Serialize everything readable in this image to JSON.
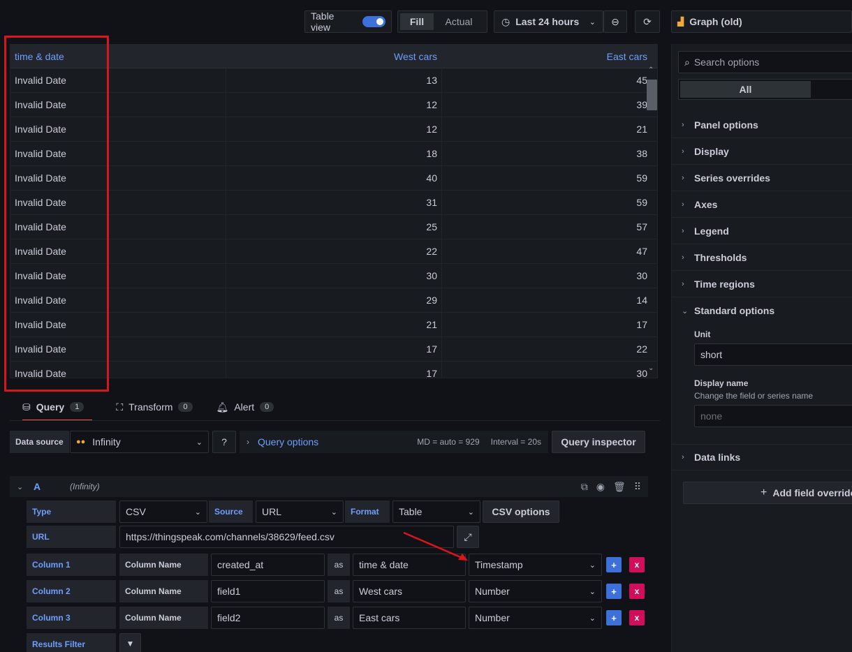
{
  "toolbar": {
    "table_view_label": "Table view",
    "fill_label": "Fill",
    "actual_label": "Actual",
    "time_range": "Last 24 hours",
    "visualization": "Graph (old)"
  },
  "table": {
    "columns": [
      "time & date",
      "West cars",
      "East cars"
    ],
    "rows": [
      [
        "Invalid Date",
        "13",
        "45"
      ],
      [
        "Invalid Date",
        "12",
        "39"
      ],
      [
        "Invalid Date",
        "12",
        "21"
      ],
      [
        "Invalid Date",
        "18",
        "38"
      ],
      [
        "Invalid Date",
        "40",
        "59"
      ],
      [
        "Invalid Date",
        "31",
        "59"
      ],
      [
        "Invalid Date",
        "25",
        "57"
      ],
      [
        "Invalid Date",
        "22",
        "47"
      ],
      [
        "Invalid Date",
        "30",
        "30"
      ],
      [
        "Invalid Date",
        "29",
        "14"
      ],
      [
        "Invalid Date",
        "21",
        "17"
      ],
      [
        "Invalid Date",
        "17",
        "22"
      ],
      [
        "Invalid Date",
        "17",
        "30"
      ]
    ]
  },
  "tabs": [
    {
      "label": "Query",
      "count": "1"
    },
    {
      "label": "Transform",
      "count": "0"
    },
    {
      "label": "Alert",
      "count": "0"
    }
  ],
  "datasource": {
    "label": "Data source",
    "value": "Infinity",
    "query_options": "Query options",
    "md": "MD = auto = 929",
    "interval": "Interval = 20s",
    "inspector": "Query inspector"
  },
  "query": {
    "ref": "A",
    "ds_name": "(Infinity)",
    "type_label": "Type",
    "type_value": "CSV",
    "source_label": "Source",
    "source_value": "URL",
    "format_label": "Format",
    "format_value": "Table",
    "csv_options": "CSV options",
    "url_label": "URL",
    "url_value": "https://thingspeak.com/channels/38629/feed.csv",
    "column_name_label": "Column Name",
    "as_label": "as",
    "columns": [
      {
        "label": "Column 1",
        "selector": "created_at",
        "alias": "time & date",
        "type": "Timestamp"
      },
      {
        "label": "Column 2",
        "selector": "field1",
        "alias": "West cars",
        "type": "Number"
      },
      {
        "label": "Column 3",
        "selector": "field2",
        "alias": "East cars",
        "type": "Number"
      }
    ],
    "results_filter": "Results Filter"
  },
  "options": {
    "search_placeholder": "Search options",
    "all_tab": "All",
    "sections": [
      "Panel options",
      "Display",
      "Series overrides",
      "Axes",
      "Legend",
      "Thresholds",
      "Time regions"
    ],
    "standard_options": "Standard options",
    "unit_label": "Unit",
    "unit_value": "short",
    "display_name_label": "Display name",
    "display_name_desc": "Change the field or series name",
    "display_name_placeholder": "none",
    "data_links": "Data links",
    "add_override": "Add field override"
  },
  "colors": {
    "background": "#111217",
    "panel": "#181b1f",
    "accent_blue": "#6e9fff",
    "primary": "#3d71d9",
    "danger": "#d10e5c",
    "annotation_red": "#d9161c"
  }
}
